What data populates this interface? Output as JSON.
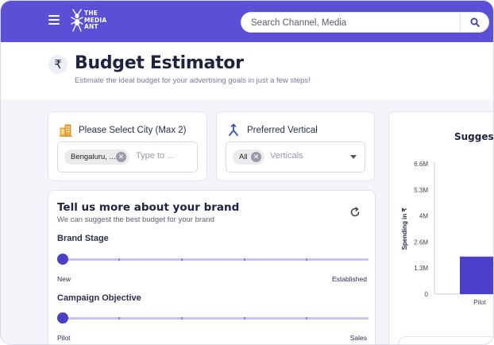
{
  "header": {
    "logo_lines": [
      "THE",
      "MEDIA",
      "ANT"
    ],
    "search_placeholder": "Search Channel, Media"
  },
  "page": {
    "title": "Budget Estimator",
    "subtitle": "Estimate the ideal budget for your advertising goals in just a few steps!",
    "title_icon": "₹"
  },
  "city": {
    "label": "Please Select City (Max 2)",
    "chip": "Bengaluru, ...",
    "placeholder": "Type to ..."
  },
  "vertical": {
    "label": "Preferred Vertical",
    "chip": "All",
    "placeholder": "Verticals"
  },
  "brand": {
    "title": "Tell us more about your brand",
    "subtitle": "We can suggest the best budget for your brand",
    "brand_stage": {
      "label": "Brand Stage",
      "min_label": "New",
      "max_label": "Established",
      "value_fraction": 0
    },
    "campaign_objective": {
      "label": "Campaign Objective",
      "min_label": "Pilot",
      "max_label": "Sales",
      "value_fraction": 0
    }
  },
  "chart_data": {
    "type": "bar",
    "title": "Suggeste",
    "ylabel": "Spending in ₹",
    "yticks": [
      "0",
      "1.3M",
      "2.6M",
      "4M",
      "5.3M",
      "6.6M"
    ],
    "ylim": [
      0,
      6.6
    ],
    "categories": [
      "Pilot"
    ],
    "values": [
      1.9
    ],
    "bar_color": "#4b3ec9"
  }
}
